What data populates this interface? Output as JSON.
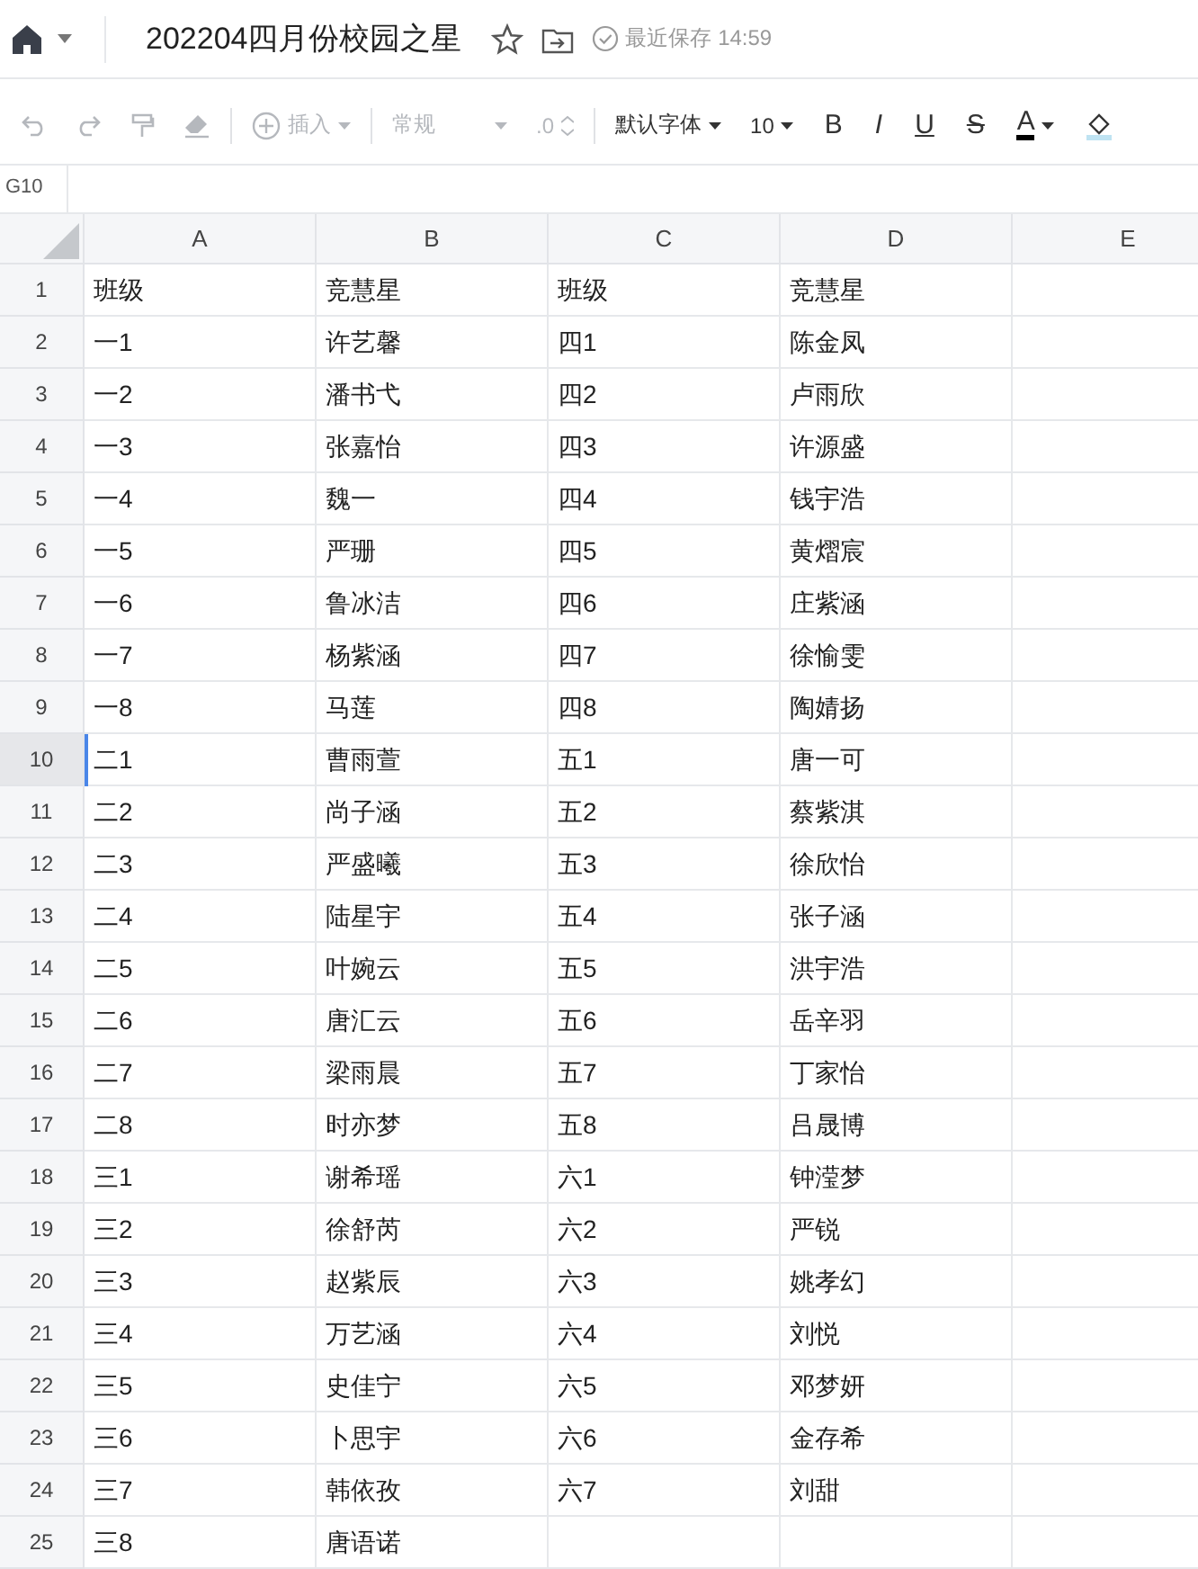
{
  "header": {
    "title": "202204四月份校园之星",
    "save_status": "最近保存 14:59"
  },
  "toolbar": [
    {
      "kind": "undo",
      "disabled": true
    },
    {
      "kind": "redo",
      "disabled": true
    },
    {
      "kind": "painter",
      "disabled": true
    },
    {
      "kind": "eraser",
      "disabled": true
    },
    {
      "kind": "separator"
    },
    {
      "kind": "insert",
      "label": "插入",
      "disabled": true
    },
    {
      "kind": "separator"
    },
    {
      "kind": "format",
      "label": "常规",
      "disabled": true
    },
    {
      "kind": "decimal",
      "label": ".0",
      "disabled": true
    },
    {
      "kind": "separator"
    },
    {
      "kind": "font",
      "label": "默认字体",
      "disabled": false
    },
    {
      "kind": "size",
      "label": "10",
      "disabled": false
    },
    {
      "kind": "bold",
      "label": "B",
      "disabled": false
    },
    {
      "kind": "italic",
      "label": "I",
      "disabled": false
    },
    {
      "kind": "underline",
      "label": "U",
      "disabled": false
    },
    {
      "kind": "strike",
      "label": "S",
      "disabled": false
    },
    {
      "kind": "color",
      "label": "A",
      "disabled": false
    },
    {
      "kind": "fill",
      "disabled": false
    }
  ],
  "name_box": "G10",
  "columns": [
    "A",
    "B",
    "C",
    "D",
    "E"
  ],
  "rows": [
    {
      "number": "1",
      "selected": false,
      "cells": [
        "班级",
        "竞慧星",
        "班级",
        "竞慧星"
      ]
    },
    {
      "number": "2",
      "selected": false,
      "cells": [
        "一1",
        "许艺馨",
        "四1",
        "陈金凤"
      ]
    },
    {
      "number": "3",
      "selected": false,
      "cells": [
        "一2",
        "潘书弋",
        "四2",
        "卢雨欣"
      ]
    },
    {
      "number": "4",
      "selected": false,
      "cells": [
        "一3",
        "张嘉怡",
        "四3",
        "许源盛"
      ]
    },
    {
      "number": "5",
      "selected": false,
      "cells": [
        "一4",
        "魏一",
        "四4",
        "钱宇浩"
      ]
    },
    {
      "number": "6",
      "selected": false,
      "cells": [
        "一5",
        "严珊",
        "四5",
        "黄熠宸"
      ]
    },
    {
      "number": "7",
      "selected": false,
      "cells": [
        "一6",
        "鲁冰洁",
        "四6",
        "庄紫涵"
      ]
    },
    {
      "number": "8",
      "selected": false,
      "cells": [
        "一7",
        "杨紫涵",
        "四7",
        "徐愉雯"
      ]
    },
    {
      "number": "9",
      "selected": false,
      "cells": [
        "一8",
        "马莲",
        "四8",
        "陶婧扬"
      ]
    },
    {
      "number": "10",
      "selected": true,
      "cells": [
        "二1",
        "曹雨萱",
        "五1",
        "唐一可"
      ]
    },
    {
      "number": "11",
      "selected": false,
      "cells": [
        "二2",
        "尚子涵",
        "五2",
        "蔡紫淇"
      ]
    },
    {
      "number": "12",
      "selected": false,
      "cells": [
        "二3",
        "严盛曦",
        "五3",
        "徐欣怡"
      ]
    },
    {
      "number": "13",
      "selected": false,
      "cells": [
        "二4",
        "陆星宇",
        "五4",
        "张子涵"
      ]
    },
    {
      "number": "14",
      "selected": false,
      "cells": [
        "二5",
        "叶婉云",
        "五5",
        "洪宇浩"
      ]
    },
    {
      "number": "15",
      "selected": false,
      "cells": [
        "二6",
        "唐汇云",
        "五6",
        "岳辛羽"
      ]
    },
    {
      "number": "16",
      "selected": false,
      "cells": [
        "二7",
        "梁雨晨",
        "五7",
        "丁家怡"
      ]
    },
    {
      "number": "17",
      "selected": false,
      "cells": [
        "二8",
        "时亦梦",
        "五8",
        "吕晟博"
      ]
    },
    {
      "number": "18",
      "selected": false,
      "cells": [
        "三1",
        "谢希瑶",
        "六1",
        "钟滢梦"
      ]
    },
    {
      "number": "19",
      "selected": false,
      "cells": [
        "三2",
        "徐舒芮",
        "六2",
        "严锐"
      ]
    },
    {
      "number": "20",
      "selected": false,
      "cells": [
        "三3",
        "赵紫辰",
        "六3",
        "姚孝幻"
      ]
    },
    {
      "number": "21",
      "selected": false,
      "cells": [
        "三4",
        "万艺涵",
        "六4",
        "刘悦"
      ]
    },
    {
      "number": "22",
      "selected": false,
      "cells": [
        "三5",
        "史佳宁",
        "六5",
        "邓梦妍"
      ]
    },
    {
      "number": "23",
      "selected": false,
      "cells": [
        "三6",
        "卜思宇",
        "六6",
        "金存希"
      ]
    },
    {
      "number": "24",
      "selected": false,
      "cells": [
        "三7",
        "韩依孜",
        "六7",
        "刘甜"
      ]
    },
    {
      "number": "25",
      "selected": false,
      "cells": [
        "三8",
        "唐语诺"
      ]
    }
  ]
}
